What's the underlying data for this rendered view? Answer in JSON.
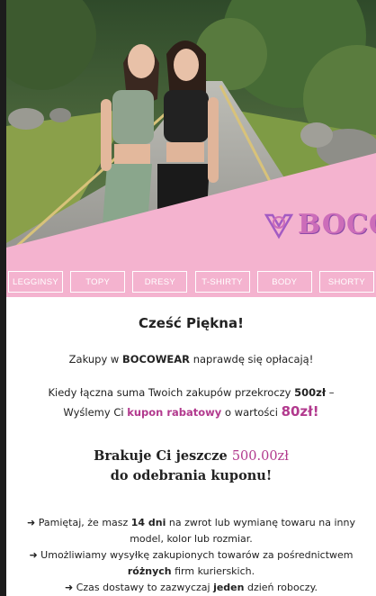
{
  "brand": {
    "logo_text": "BOCO",
    "accent": "#b23a8e",
    "pink": "#f4b3cf"
  },
  "nav": [
    "LEGGINSY",
    "TOPY",
    "DRESY",
    "T-SHIRTY",
    "BODY",
    "SHORTY"
  ],
  "greeting": "Cześć Piękna!",
  "intro": {
    "pre": "Zakupy w ",
    "brand": "BOCOWEAR",
    "post": " naprawdę się opłacają!"
  },
  "offer": {
    "line1_pre": "Kiedy łączna suma Twoich zakupów przekroczy ",
    "line1_amount": "500zł",
    "line1_post": " –",
    "line2_pre": "Wyślemy Ci ",
    "line2_kupon": "kupon rabatowy",
    "line2_mid": " o wartości ",
    "line2_value": "80zł!"
  },
  "missing": {
    "pre": "Brakuje Ci jeszcze ",
    "amount": "500.00zł",
    "line2": "do odebrania kuponu!"
  },
  "notes": {
    "n1_pre": "➜ Pamiętaj, że masz ",
    "n1_bold": "14 dni",
    "n1_post": " na zwrot lub wymianę towaru na inny model, kolor lub rozmiar.",
    "n2_pre": "➜ Umożliwiamy wysyłkę zakupionych towarów za pośrednictwem ",
    "n2_bold": "różnych",
    "n2_post": " firm kurierskich.",
    "n3_pre": "➜ Czas dostawy to zazwyczaj ",
    "n3_bold": "jeden",
    "n3_post": " dzień roboczy."
  }
}
